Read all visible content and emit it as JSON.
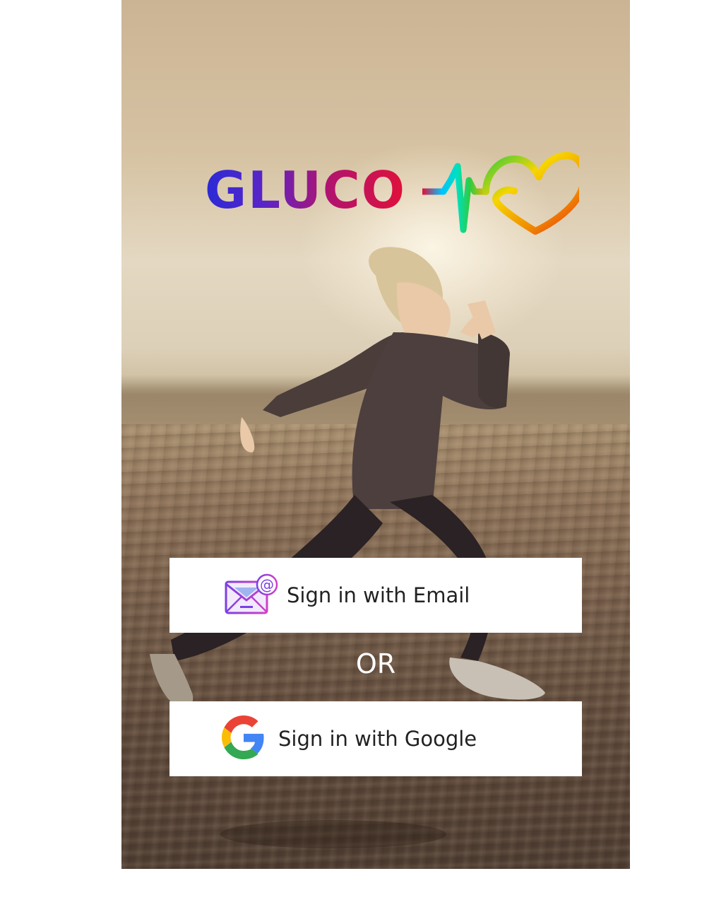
{
  "app": {
    "logo_text": "GLUCO",
    "logo_colors": [
      "#2a2bd6",
      "#b2136e",
      "#e0113a",
      "#00c2ff",
      "#2ecc40",
      "#f7b500",
      "#e8251b"
    ]
  },
  "actions": {
    "email_label": "Sign in with Email",
    "separator": "OR",
    "google_label": "Sign in with Google"
  },
  "icons": {
    "email": "email-at-icon",
    "google": "google-g-icon"
  }
}
